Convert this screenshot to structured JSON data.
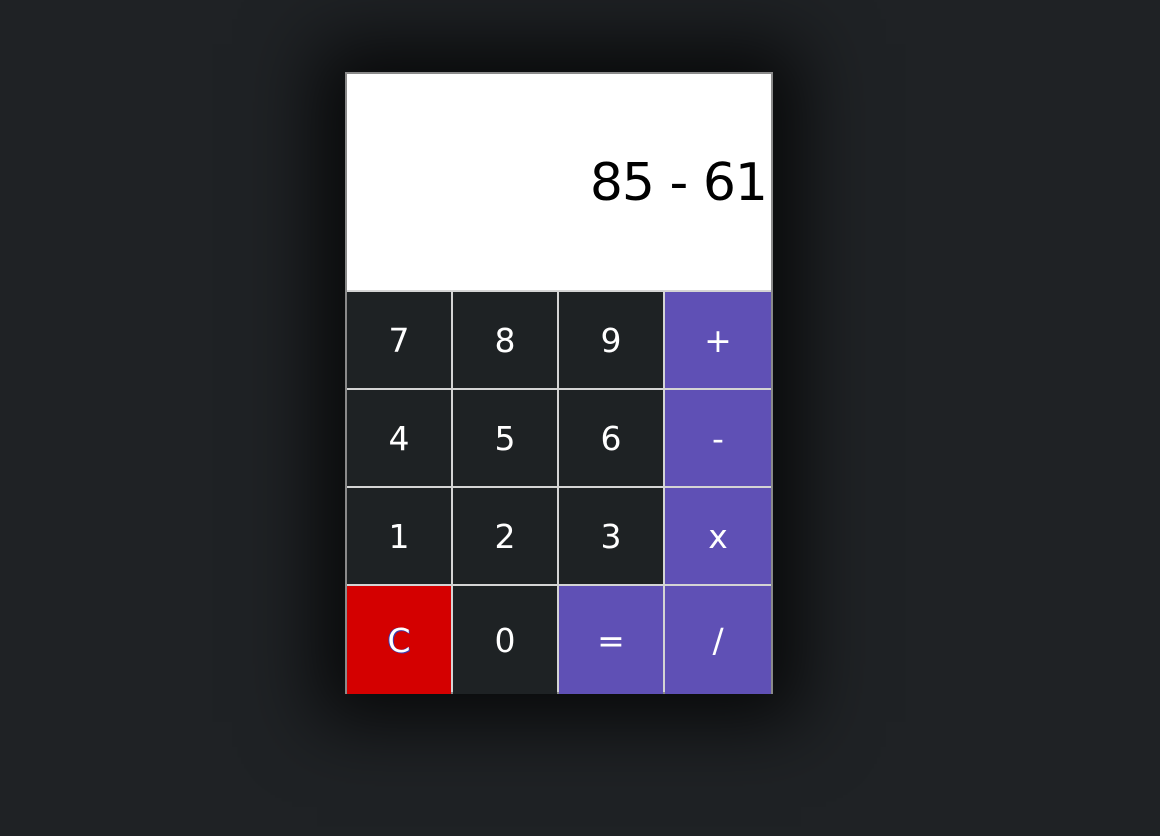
{
  "display": {
    "expression": "85 - 61"
  },
  "keys": {
    "seven": "7",
    "eight": "8",
    "nine": "9",
    "plus": "+",
    "four": "4",
    "five": "5",
    "six": "6",
    "minus": "-",
    "one": "1",
    "two": "2",
    "three": "3",
    "multiply": "x",
    "clear": "C",
    "zero": "0",
    "equals": "=",
    "divide": "/"
  },
  "colors": {
    "background": "#1f2225",
    "display_bg": "#ffffff",
    "number_key": "#1e2224",
    "operator_key": "#5f50b5",
    "clear_key": "#d40000",
    "grid_lines": "#d4d4d4"
  }
}
